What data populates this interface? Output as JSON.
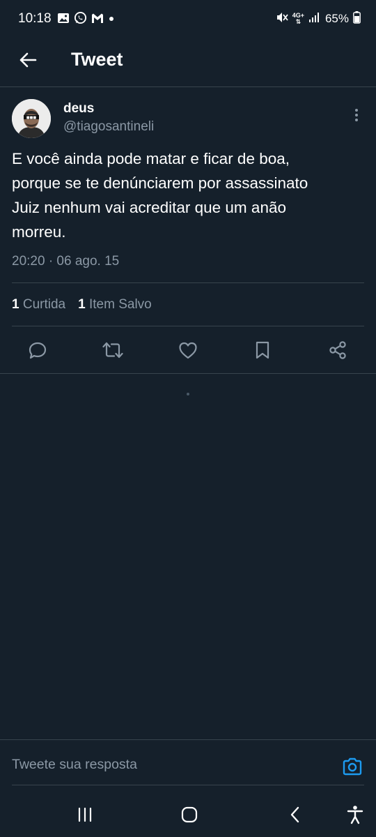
{
  "status_bar": {
    "time": "10:18",
    "battery": "65%",
    "network": "4G+"
  },
  "header": {
    "title": "Tweet"
  },
  "tweet": {
    "display_name": "deus",
    "handle": "@tiagosantineli",
    "text": "E você ainda pode matar e ficar de boa,\nporque se te denúnciarem por assassinato\nJuiz nenhum vai acreditar que um anão\nmorreu.",
    "timestamp": "20:20 · 06 ago. 15",
    "likes_count": "1",
    "likes_label": "Curtida",
    "bookmarks_count": "1",
    "bookmarks_label": "Item Salvo"
  },
  "reply": {
    "placeholder": "Tweete sua resposta"
  },
  "colors": {
    "background": "#15202b",
    "divider": "#38444d",
    "secondary_text": "#8b98a5",
    "accent": "#1d9bf0"
  }
}
